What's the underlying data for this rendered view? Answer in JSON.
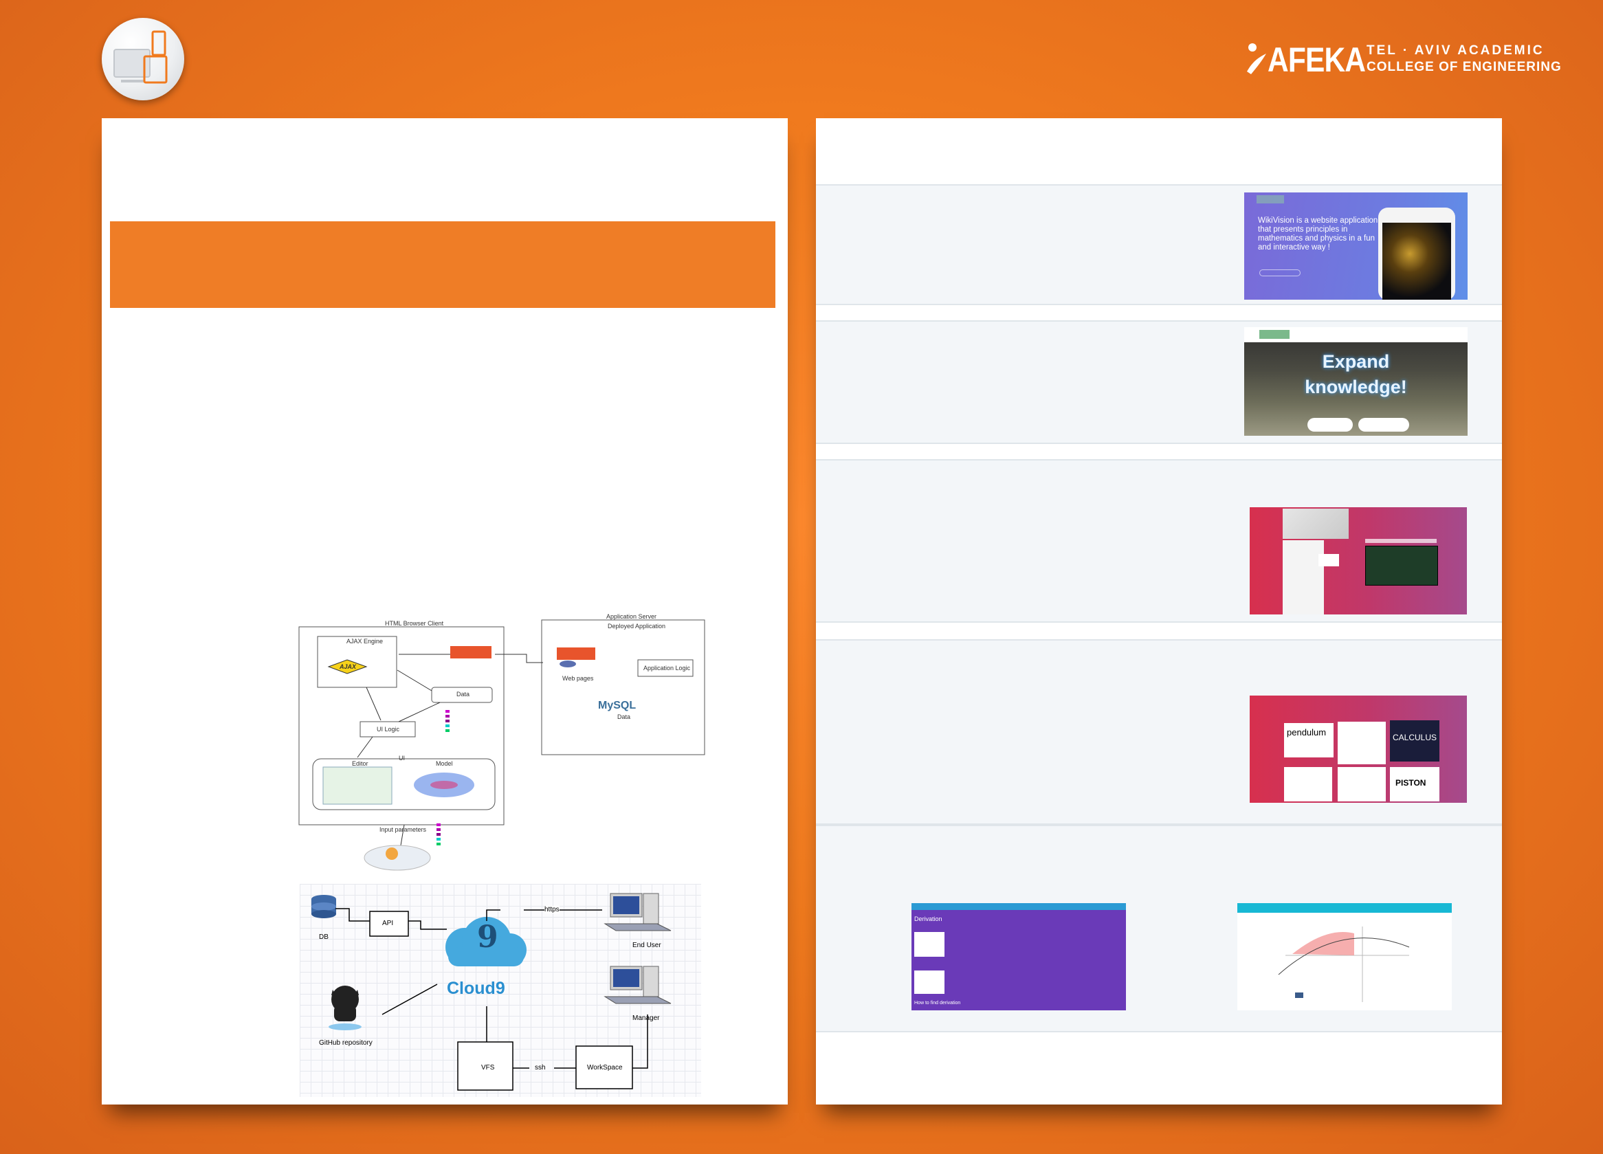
{
  "brand": {
    "name": "AFEKA",
    "line1": "TEL · AVIV ACADEMIC",
    "line2": "COLLEGE OF ENGINEERING"
  },
  "colors": {
    "background": "#f07a1e",
    "accent_band": "#ef7d26",
    "panel": "#ffffff",
    "row": "#f3f6f9"
  },
  "architecture_diagram": {
    "client_title": "HTML Browser Client",
    "server_title": "Application Server",
    "ajax_engine": "AJAX Engine",
    "ajax_logo": "AJAX",
    "data": "Data",
    "ui_logic": "UI Logic",
    "ui": "UI",
    "editor": "Editor",
    "model": "Model",
    "input_parameters": "Input parameters",
    "deployed_application": "Deployed Application",
    "web_pages": "Web pages",
    "application_logic": "Application Logic",
    "mysql": "MySQL",
    "server_data": "Data"
  },
  "deployment_diagram": {
    "db": "DB",
    "api": "API",
    "cloud9": "Cloud9",
    "cloud9_digit": "9",
    "https": "https",
    "end_user": "End User",
    "manager": "Manager",
    "github": "GitHub repository",
    "vfs": "VFS",
    "ssh": "ssh",
    "workspace": "WorkSpace"
  },
  "screenshots": {
    "wikivision_text": "WikiVision is a website application that presents principles in mathematics and physics in a fun and interactive way !",
    "expand_line1": "Expand",
    "expand_line2": "knowledge!",
    "card_pendulum": "pendulum",
    "card_calculus": "CALCULUS",
    "card_piston": "PISTON",
    "derivation_title": "Derivation",
    "derivation_link": "How to find derivation"
  }
}
